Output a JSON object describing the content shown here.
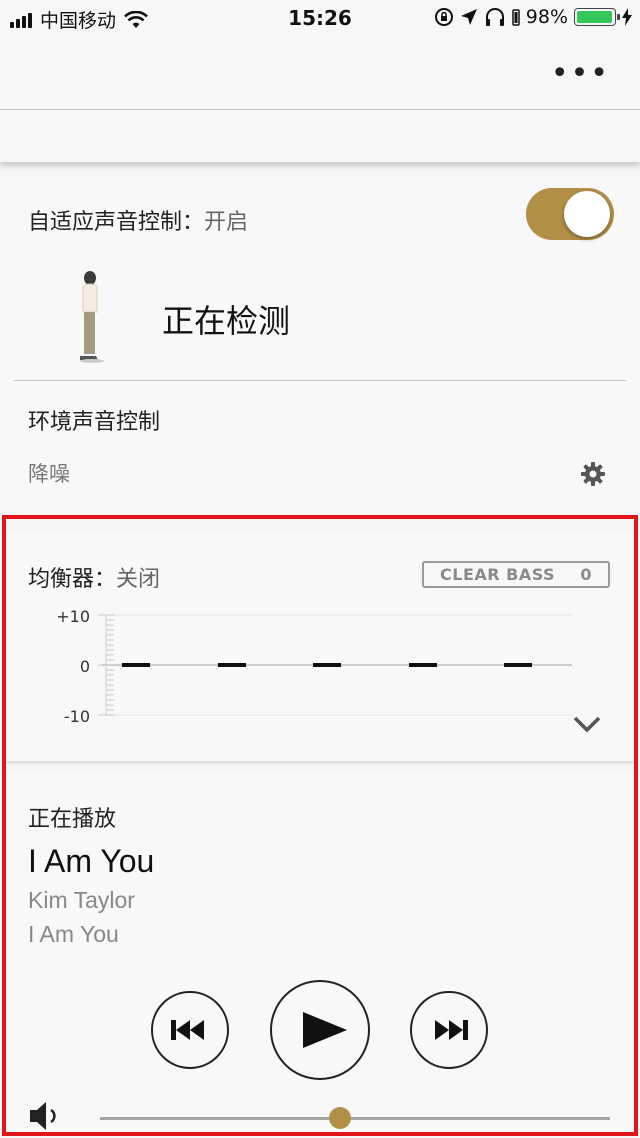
{
  "status_bar": {
    "carrier": "中国移动",
    "time": "15:26",
    "battery_percent": "98%",
    "battery_level": 0.98
  },
  "nav": {
    "more_icon": "more-icon"
  },
  "adaptive_sound": {
    "label": "自适应声音控制：",
    "value": "开启",
    "toggle_on": true,
    "status": "正在检测"
  },
  "ambient_sound": {
    "title": "环境声音控制",
    "mode": "降噪",
    "settings_icon": "gear-icon"
  },
  "equalizer": {
    "label": "均衡器：",
    "value": "关闭",
    "clear_bass_label": "CLEAR BASS",
    "clear_bass_value": "0",
    "y_labels": [
      "+10",
      "0",
      "-10"
    ],
    "band_levels": [
      0,
      0,
      0,
      0,
      0
    ],
    "range": [
      -10,
      10
    ]
  },
  "now_playing": {
    "label": "正在播放",
    "title": "I Am You",
    "artist": "Kim Taylor",
    "album": "I Am You",
    "volume_level": 0.47
  },
  "colors": {
    "accent": "#b28f47",
    "highlight_frame": "#e4141b"
  }
}
